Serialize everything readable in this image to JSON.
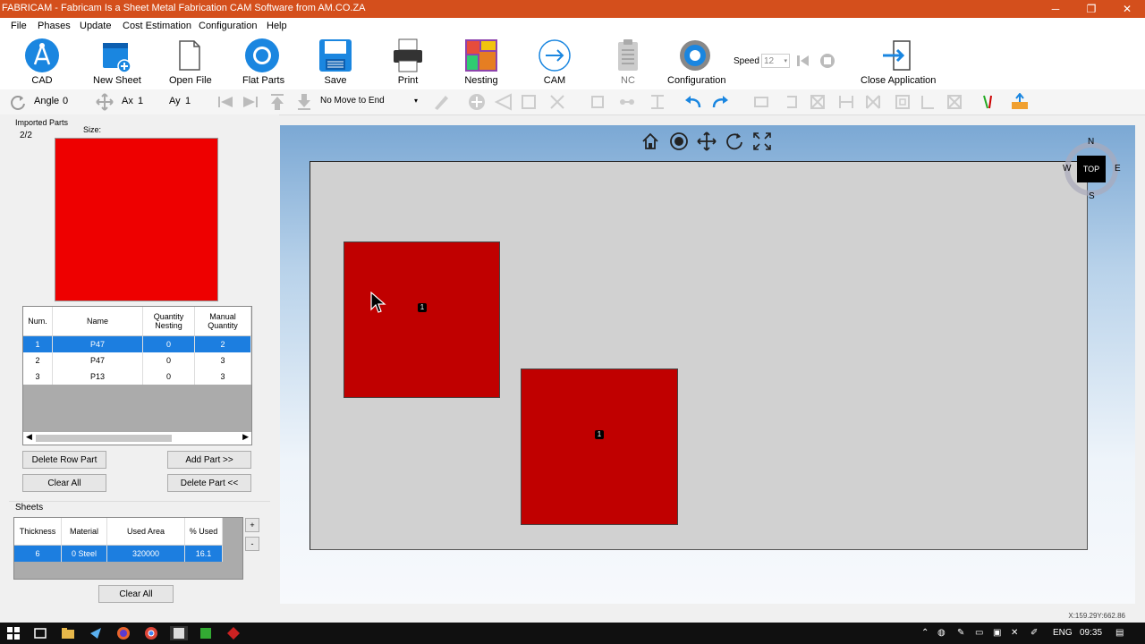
{
  "window": {
    "title": "FABRICAM - Fabricam Is a Sheet Metal Fabrication CAM Software from AM.CO.ZA",
    "minimize": "─",
    "maximize": "❐",
    "close": "✕"
  },
  "menu": [
    "File",
    "Phases",
    "Update",
    "Cost Estimation",
    "Configuration",
    "Help"
  ],
  "ribbon": {
    "cad": "CAD",
    "new_sheet": "New Sheet",
    "open_file": "Open File",
    "flat_parts": "Flat Parts",
    "save": "Save",
    "print": "Print",
    "nesting": "Nesting",
    "cam": "CAM",
    "nc": "NC",
    "configuration": "Configuration",
    "speed_label": "Speed",
    "speed_value": "12",
    "close_application": "Close Application"
  },
  "toolbar2": {
    "angle_label": "Angle",
    "angle_value": "0",
    "ax_label": "Ax",
    "ax_value": "1",
    "ay_label": "Ay",
    "ay_value": "1",
    "move_select": "No Move to End"
  },
  "imported_parts": {
    "label": "Imported Parts",
    "count": "2/2",
    "size_label": "Size:",
    "preview_color": "#ee0000",
    "columns": [
      "Num.",
      "Name",
      "Quantity Nesting",
      "Manual Quantity"
    ],
    "rows": [
      {
        "num": "1",
        "name": "P47",
        "qn": "0",
        "mq": "2"
      },
      {
        "num": "2",
        "name": "P47",
        "qn": "0",
        "mq": "3"
      },
      {
        "num": "3",
        "name": "P13",
        "qn": "0",
        "mq": "3"
      }
    ],
    "delete_row_part": "Delete Row Part",
    "add_part": "Add Part >>",
    "clear_all": "Clear All",
    "delete_part": "Delete Part <<"
  },
  "sheets": {
    "label": "Sheets",
    "columns": [
      "Thickness",
      "Material",
      "Used Area",
      "% Used"
    ],
    "rows": [
      {
        "thickness": "6",
        "material_id": "0",
        "material": "Steel",
        "used_area": "320000",
        "used": "16.1"
      }
    ],
    "plus": "+",
    "minus": "-",
    "clear_all": "Clear All"
  },
  "viewport": {
    "compass": {
      "n": "N",
      "s": "S",
      "e": "E",
      "w": "W",
      "view": "TOP"
    },
    "part_labels": [
      "1",
      "1"
    ],
    "part_color": "#c00000"
  },
  "status": {
    "coords": "X:159.29Y:662.86"
  },
  "taskbar": {
    "lang": "ENG",
    "time": "09:35"
  }
}
